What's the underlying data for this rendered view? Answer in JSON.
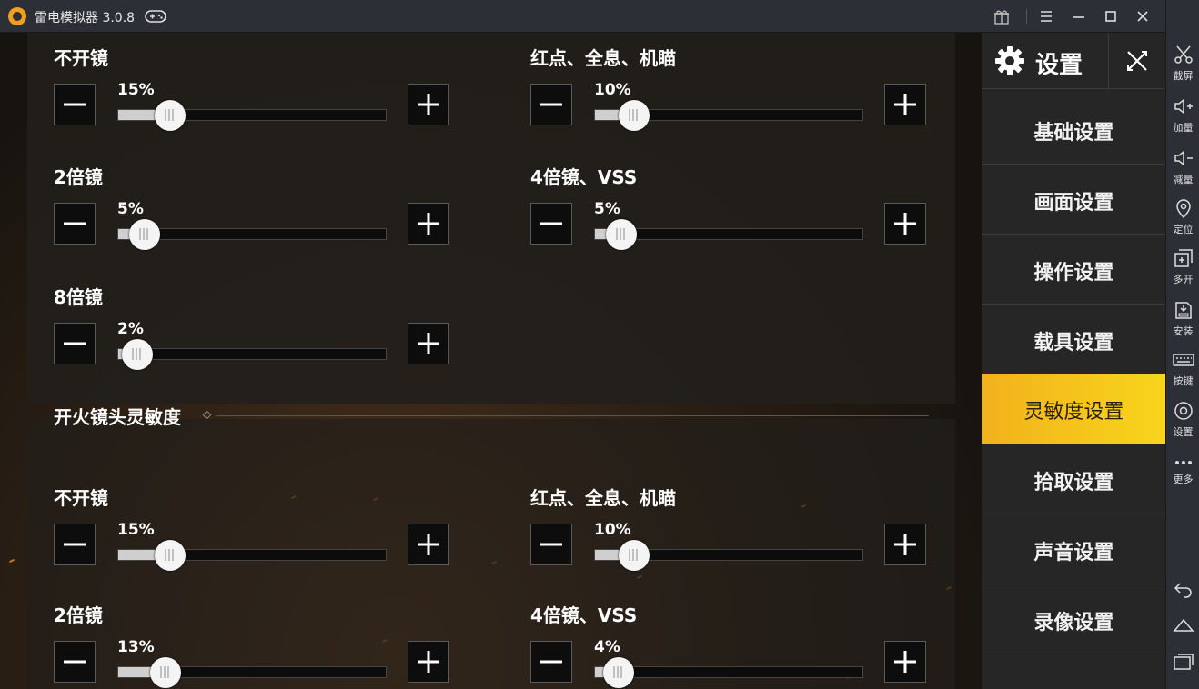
{
  "window": {
    "title": "雷电模拟器 3.0.8"
  },
  "settings": {
    "title": "设置",
    "menu": [
      {
        "label": "基础设置",
        "active": false
      },
      {
        "label": "画面设置",
        "active": false
      },
      {
        "label": "操作设置",
        "active": false
      },
      {
        "label": "载具设置",
        "active": false
      },
      {
        "label": "灵敏度设置",
        "active": true
      },
      {
        "label": "拾取设置",
        "active": false
      },
      {
        "label": "声音设置",
        "active": false
      },
      {
        "label": "录像设置",
        "active": false
      }
    ]
  },
  "section1": {
    "sliders": [
      {
        "label": "不开镜",
        "value": 15,
        "display": "15%"
      },
      {
        "label": "红点、全息、机瞄",
        "value": 10,
        "display": "10%"
      },
      {
        "label": "2倍镜",
        "value": 5,
        "display": "5%"
      },
      {
        "label": "4倍镜、VSS",
        "value": 5,
        "display": "5%"
      },
      {
        "label": "8倍镜",
        "value": 2,
        "display": "2%"
      }
    ]
  },
  "section2": {
    "title": "开火镜头灵敏度",
    "sliders": [
      {
        "label": "不开镜",
        "value": 15,
        "display": "15%"
      },
      {
        "label": "红点、全息、机瞄",
        "value": 10,
        "display": "10%"
      },
      {
        "label": "2倍镜",
        "value": 13,
        "display": "13%"
      },
      {
        "label": "4倍镜、VSS",
        "value": 4,
        "display": "4%"
      }
    ]
  },
  "toolbar": {
    "items": [
      {
        "label": "截屏",
        "icon": "scissors-icon"
      },
      {
        "label": "加量",
        "icon": "volume-up-icon"
      },
      {
        "label": "减量",
        "icon": "volume-down-icon"
      },
      {
        "label": "定位",
        "icon": "location-icon"
      },
      {
        "label": "多开",
        "icon": "multi-instance-icon"
      },
      {
        "label": "安装",
        "icon": "apk-install-icon"
      },
      {
        "label": "按键",
        "icon": "keyboard-icon"
      },
      {
        "label": "设置",
        "icon": "settings-icon"
      },
      {
        "label": "更多",
        "icon": "more-icon"
      }
    ]
  },
  "colors": {
    "accent": "#f5c21b",
    "sidebar": "#262626",
    "titlebar": "#2c2f36"
  }
}
